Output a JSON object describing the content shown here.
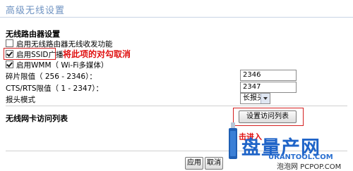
{
  "page": {
    "title": "高级无线设置"
  },
  "router_section": {
    "title": "无线路由器设置",
    "options": [
      {
        "label": "启用无线路由器无线收发功能",
        "checked": false
      },
      {
        "label": "启用SSID广播",
        "checked": true
      },
      {
        "label": "启用WMM（ Wi-Fi多媒体）",
        "checked": true
      }
    ],
    "annotation": "将此项的对勾取消",
    "fields": [
      {
        "label": "碎片限值（ 256 - 2346）：",
        "value": "2346"
      },
      {
        "label": "CTS/RTS限值（ 1 - 2347）：",
        "value": "2347"
      },
      {
        "label": "报头模式",
        "value": "长报头"
      }
    ]
  },
  "access_section": {
    "title": "无线网卡访问列表",
    "button": "设置访问列表",
    "annotation": "击进入"
  },
  "actions": {
    "apply": "应用",
    "cancel": "取消"
  },
  "watermark": {
    "logo": "盘量产网",
    "url": "URANTOOL.COM",
    "credit": "泡泡网 PCPOP.COM"
  }
}
